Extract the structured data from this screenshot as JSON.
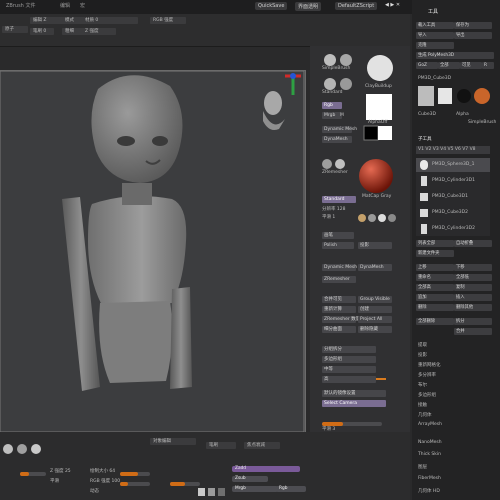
{
  "topbar": {
    "menu_left": [
      "ZBrush 文件",
      "编辑",
      "宏"
    ],
    "menu_right": [
      "QuickSave",
      "界面透明",
      "DefaultZScript"
    ],
    "right_title": "工具"
  },
  "toolbar2": {
    "items": [
      "原子",
      "编辑 Z",
      "模式",
      "材质 0",
      "笔刷 0",
      "粗细",
      "Z 强度",
      "RGB 强度"
    ]
  },
  "mid": {
    "material_labels": [
      "SimpleBrush",
      "ClayBuildup",
      "Standard",
      "AlphaOff",
      "MatCap Gray"
    ],
    "color_labels": [
      "Rgb",
      "Mrgb",
      "M"
    ],
    "sections": [
      "Dynamic Mesh",
      "DynaMesh",
      "ZRemesher",
      "分辨率 128",
      "平滑 1",
      "画笔",
      "Standard",
      "Polish",
      "投影",
      "合并可见",
      "Group Visible",
      "重新计算",
      "创建",
      "ZRemesher 数量",
      "Project All",
      "细分曲面",
      "删除隐藏",
      "分组拆分",
      "Select Camera",
      "多边形组",
      "中等",
      "高"
    ],
    "bottom_items": [
      "默认的镜像设置",
      "Select Camera",
      "平滑 3",
      "平滑 0.25",
      "Color",
      "翻转"
    ],
    "subtool_items": [
      "DynaMesh",
      "Groups",
      "Polish",
      "Blur 2",
      "Project",
      "ZRemesher"
    ]
  },
  "rpanel": {
    "title": "工具",
    "top_buttons": [
      "载入工具",
      "保存为",
      "导入",
      "导出",
      "克隆",
      "生成 PolyMesh3D",
      "GoZ",
      "全部",
      "可见",
      "R"
    ],
    "quick_labels": [
      "PM3D_Cube3D",
      "Alpha",
      "PolyMesh3D",
      "Cube3D",
      "Cylinder3D",
      "SimpleBrush"
    ],
    "subtool_header": "子工具",
    "subtools": [
      "PM3D_Sphere3D_1",
      "PM3D_Cylinder3D1",
      "PM3D_Cube3D1",
      "PM3D_Cube3D2",
      "PM3D_Cylinder3D2"
    ],
    "actions": [
      "列表全部",
      "自动折叠",
      "新建文件夹",
      "上移",
      "下移",
      "重命名",
      "全部低",
      "全部高",
      "复制",
      "追加",
      "插入",
      "删除",
      "删除其他",
      "全部删除",
      "拆分",
      "合并",
      "提取",
      "投影",
      "重新网格化",
      "多分辨率"
    ],
    "bottom_list": [
      "布尔",
      "多边形组",
      "接触",
      "几何体",
      "ArrayMesh",
      "NanoMesh",
      "Thick Skin",
      "图层",
      "FiberMesh",
      "几何体 HD"
    ]
  },
  "bottom": {
    "labels": [
      "对象编辑",
      "笔刷",
      "焦点衰减",
      "Z 强度 25",
      "平滑",
      "绘制大小 64",
      "RGB 强度 100",
      "动态"
    ],
    "pills": [
      "Zadd",
      "Zsub",
      "Mrgb",
      "Rgb"
    ],
    "slider_levels": [
      0.35,
      0.6,
      0.25,
      0.5
    ]
  },
  "colors": {
    "accent_orange": "#d97b1e",
    "accent_purple": "#7a5a99",
    "panel_dark": "#232324",
    "viewport": "#3c3d3f"
  }
}
